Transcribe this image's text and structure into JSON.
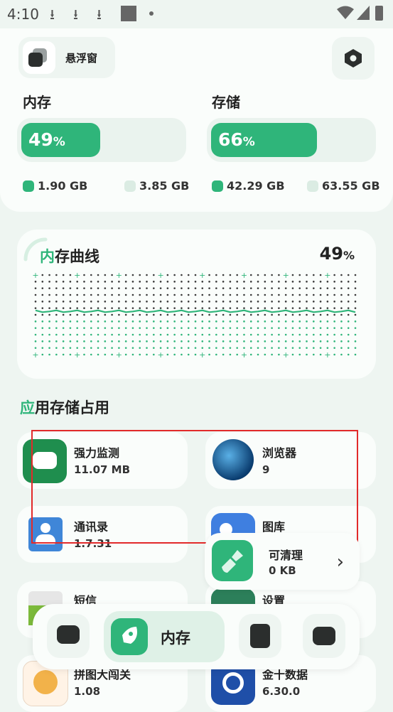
{
  "status": {
    "time": "4:10"
  },
  "header": {
    "floating_window_label": "悬浮窗"
  },
  "memory": {
    "title": "内存",
    "percent": "49",
    "percent_unit": "%",
    "fill_fraction": 0.49,
    "used": "1.90 GB",
    "total": "3.85 GB"
  },
  "storage": {
    "title": "存储",
    "percent": "66",
    "percent_unit": "%",
    "fill_fraction": 0.66,
    "used": "42.29 GB",
    "total": "63.55 GB"
  },
  "curve": {
    "title_highlight": "内",
    "title_rest": "存曲线",
    "percent": "49",
    "percent_unit": "%"
  },
  "apps": {
    "title_highlight": "应",
    "title_rest": "用存储占用",
    "items": [
      {
        "name": "强力监测",
        "value": "11.07 MB"
      },
      {
        "name": "浏览器",
        "value": "9"
      },
      {
        "name": "通讯录",
        "value": "1.7.31"
      },
      {
        "name": "图库",
        "value": ""
      },
      {
        "name": "短信",
        "value": ""
      },
      {
        "name": "设置",
        "value": ""
      },
      {
        "name": "拼图大闯关",
        "value": "1.08"
      },
      {
        "name": "金十数据",
        "value": "6.30.0"
      }
    ]
  },
  "cleanable": {
    "label": "可清理",
    "value": "0 KB"
  },
  "nav": {
    "active_label": "内存"
  },
  "colors": {
    "accent": "#2fb57a",
    "background": "#eef5f1",
    "highlight_box": "#e22a2a"
  }
}
